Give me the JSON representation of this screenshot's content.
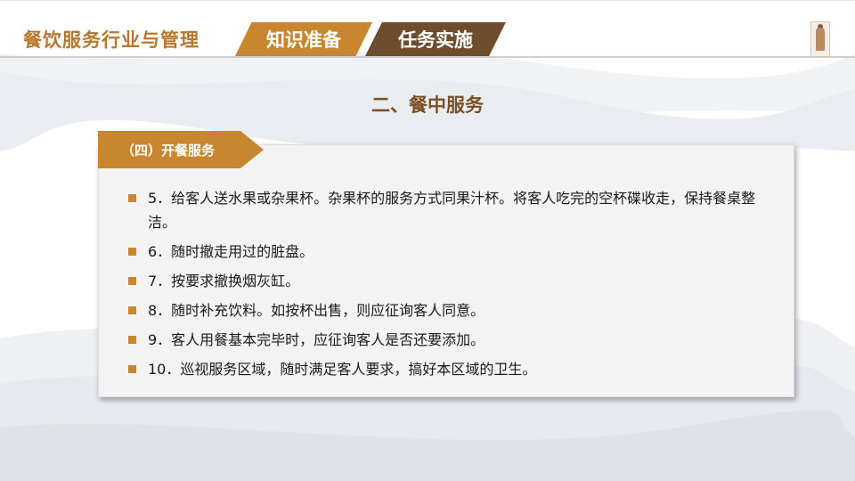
{
  "header": {
    "course_title": "餐饮服务行业与管理",
    "tabs": [
      {
        "label": "知识准备"
      },
      {
        "label": "任务实施"
      }
    ]
  },
  "section_title": "二、餐中服务",
  "card": {
    "tag": "（四）开餐服务",
    "items": [
      {
        "text": "5．给客人送水果或杂果杯。杂果杯的服务方式同果汁杯。将客人吃完的空杯碟收走，保持餐桌整洁。"
      },
      {
        "text": "6．随时撤走用过的脏盘。"
      },
      {
        "text": "7．按要求撤换烟灰缸。"
      },
      {
        "text": "8．随时补充饮料。如按杯出售，则应征询客人同意。"
      },
      {
        "text": "9．客人用餐基本完毕时，应征询客人是否还要添加。"
      },
      {
        "text": "10．巡视服务区域，随时满足客人要求，搞好本区域的卫生。"
      }
    ]
  },
  "colors": {
    "accent": "#c8862f",
    "dark_tab": "#6e4d2c",
    "title_brown": "#7a4f25"
  }
}
